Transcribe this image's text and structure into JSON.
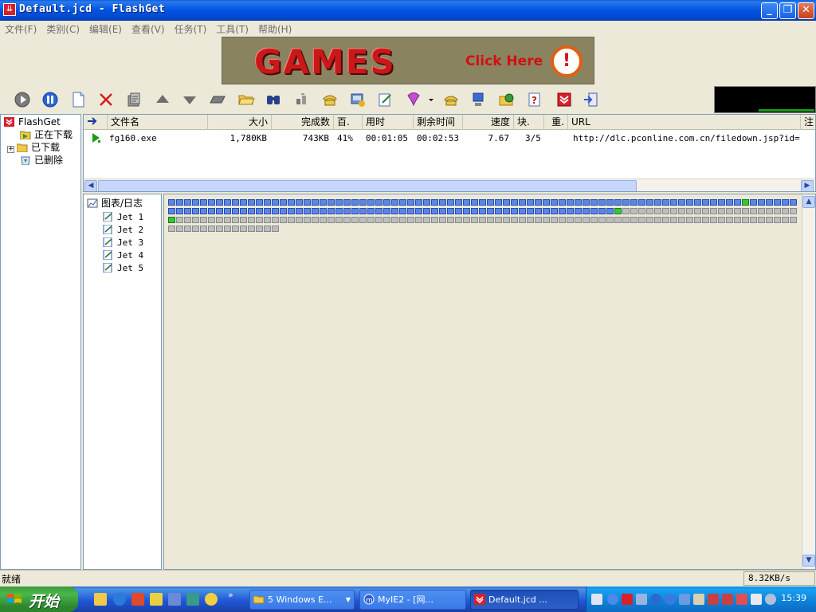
{
  "window": {
    "title": "Default.jcd - FlashGet"
  },
  "menu": [
    "文件(F)",
    "类别(C)",
    "编辑(E)",
    "查看(V)",
    "任务(T)",
    "工具(T)",
    "帮助(H)"
  ],
  "banner": {
    "headline": "GAMES",
    "cta": "Click Here",
    "badge": "!"
  },
  "toolbar": {
    "buttons": [
      "start-icon",
      "pause-icon",
      "new-icon",
      "delete-icon",
      "properties-icon",
      "move-up-icon",
      "move-down-icon",
      "open-folder-icon",
      "find-icon",
      "find-next-icon",
      "dial-icon",
      "hangup-icon",
      "options-icon",
      "site-explorer-icon",
      "connect-icon",
      "monitor-icon",
      "web-icon",
      "help-icon",
      "flashget-icon",
      "exit-icon"
    ]
  },
  "categories": {
    "root": "FlashGet",
    "items": [
      {
        "label": "正在下载",
        "icon": "downloading-folder-icon"
      },
      {
        "label": "已下载",
        "icon": "downloaded-folder-icon"
      },
      {
        "label": "已删除",
        "icon": "recycle-bin-icon"
      }
    ]
  },
  "task_list": {
    "columns": [
      "文件名",
      "大小",
      "完成数",
      "百.",
      "用时",
      "剩余时间",
      "速度",
      "块.",
      "重.",
      "URL",
      "注"
    ],
    "rows": [
      {
        "name": "fg160.exe",
        "size": "1,780KB",
        "done": "743KB",
        "percent": "41%",
        "elapsed": "00:01:05",
        "remaining": "00:02:53",
        "speed": "7.67",
        "blocks": "3/5",
        "retry": "",
        "url": "http://dlc.pconline.com.cn/filedown.jsp?id=...",
        "comment": ""
      }
    ]
  },
  "threads": {
    "root": "图表/日志",
    "items": [
      "Jet 1",
      "Jet 2",
      "Jet 3",
      "Jet 4",
      "Jet 5"
    ]
  },
  "block_map": {
    "total_blocks": 251,
    "done_ranges": [
      [
        0,
        72
      ],
      [
        73,
        135
      ]
    ],
    "active_blocks": [
      72,
      135,
      158
    ],
    "colors": {
      "done": "#5a86e8",
      "active": "#3ac43a",
      "todo": "#bdbdbd"
    }
  },
  "status": {
    "text": "就绪",
    "speed": "8.32KB/s"
  },
  "taskbar": {
    "start": "开始",
    "tasks": [
      {
        "label": "5 Windows E...",
        "active": false
      },
      {
        "label": "MyIE2 - [网...",
        "active": false
      },
      {
        "label": "Default.jcd ...",
        "active": true
      }
    ],
    "clock": "15:39"
  }
}
